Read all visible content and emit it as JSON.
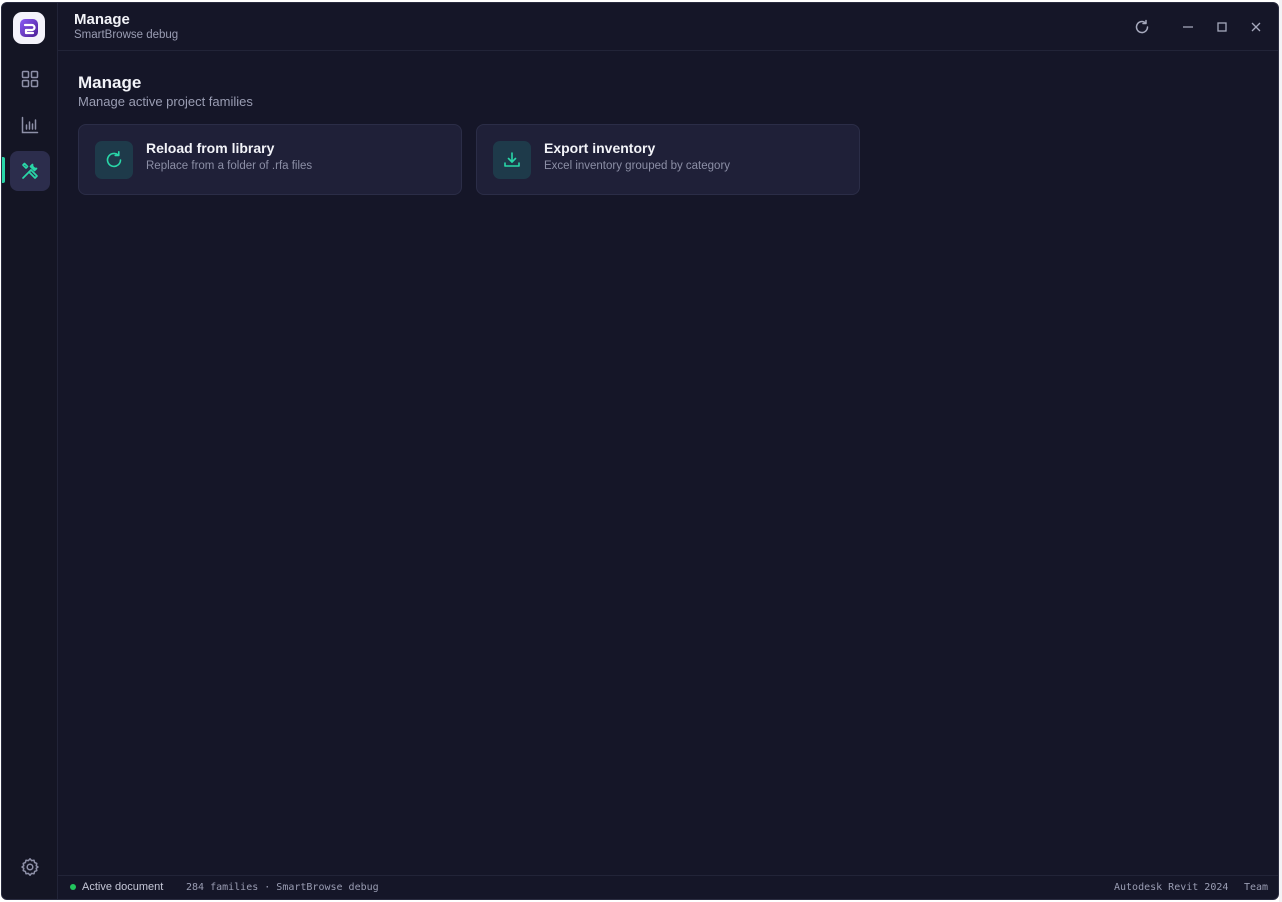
{
  "window": {
    "title": "Manage",
    "subtitle": "SmartBrowse debug"
  },
  "sidebar": {
    "items": [
      {
        "name": "dashboard",
        "icon": "grid-icon",
        "active": false
      },
      {
        "name": "analytics",
        "icon": "bar-chart-icon",
        "active": false
      },
      {
        "name": "manage",
        "icon": "tools-icon",
        "active": true
      }
    ],
    "settings_icon": "gear-icon"
  },
  "page": {
    "title": "Manage",
    "subtitle": "Manage active project families"
  },
  "cards": [
    {
      "title": "Reload from library",
      "description": "Replace from a folder of .rfa files",
      "icon": "refresh-icon"
    },
    {
      "title": "Export inventory",
      "description": "Excel inventory grouped by category",
      "icon": "download-icon"
    }
  ],
  "statusbar": {
    "document_status": "Active document",
    "details": "284 families · SmartBrowse debug",
    "app_version": "Autodesk Revit 2024",
    "team": "Team"
  },
  "colors": {
    "background": "#151628",
    "card": "#1f2038",
    "accent": "#29d7a8",
    "status_ok": "#22c55e"
  }
}
